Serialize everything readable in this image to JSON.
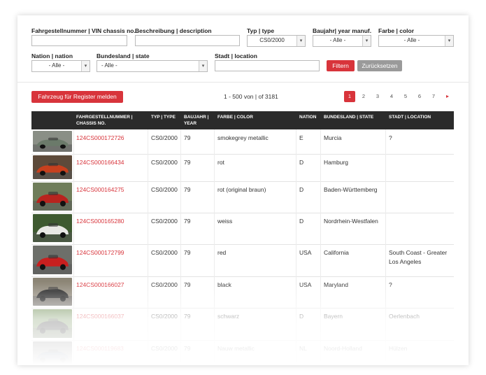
{
  "filters": {
    "vin_label": "Fahrgestellnummer | VIN chassis no.",
    "vin_value": "",
    "desc_label": "Beschreibung | description",
    "desc_value": "",
    "type_label": "Typ | type",
    "type_value": "CS0/2000",
    "year_label": "Baujahr| year manuf.",
    "year_value": "- Alle -",
    "color_label": "Farbe | color",
    "color_value": "- Alle -",
    "nation_label": "Nation | nation",
    "nation_value": "- Alle -",
    "state_label": "Bundesland | state",
    "state_value": "- Alle -",
    "city_label": "Stadt | location",
    "city_value": "",
    "filter_button": "Filtern",
    "reset_button": "Zurücksetzen"
  },
  "register_button": "Fahrzeug für Register melden",
  "result_count": "1 - 500 von | of 3181",
  "pagination": {
    "pages": [
      "1",
      "2",
      "3",
      "4",
      "5",
      "6",
      "7"
    ],
    "active": "1",
    "next": "▸"
  },
  "table": {
    "headers": {
      "chassis": "FAHRGESTELLNUMMER | CHASSIS NO.",
      "type": "TYP | TYPE",
      "year": "BAUJAHR | YEAR",
      "color": "FARBE | COLOR",
      "nation": "NATION",
      "state": "BUNDESLAND | STATE",
      "city": "STADT | LOCATION"
    },
    "rows": [
      {
        "chassis": "124CS000172726",
        "type": "CS0/2000",
        "year": "79",
        "color": "smokegrey metallic",
        "nation": "E",
        "state": "Murcia",
        "city": "?",
        "car": "#6b7a6a",
        "bg": "#8a8f86"
      },
      {
        "chassis": "124CS000166434",
        "type": "CS0/2000",
        "year": "79",
        "color": "rot",
        "nation": "D",
        "state": "Hamburg",
        "city": "",
        "car": "#c8401e",
        "bg": "#5d4a3a"
      },
      {
        "chassis": "124CS000164275",
        "type": "CS0/2000",
        "year": "79",
        "color": "rot (original braun)",
        "nation": "D",
        "state": "Baden-Württemberg",
        "city": "",
        "car": "#b8241e",
        "bg": "#6f7d5a"
      },
      {
        "chassis": "124CS000165280",
        "type": "CS0/2000",
        "year": "79",
        "color": "weiss",
        "nation": "D",
        "state": "Nordrhein-Westfalen",
        "city": "",
        "car": "#e8e8e4",
        "bg": "#3e5a30"
      },
      {
        "chassis": "124CS000172799",
        "type": "CS0/2000",
        "year": "79",
        "color": "red",
        "nation": "USA",
        "state": "California",
        "city": "South Coast - Greater Los Angeles",
        "car": "#c81f1f",
        "bg": "#6d6f6a"
      },
      {
        "chassis": "124CS000166027",
        "type": "CS0/2000",
        "year": "79",
        "color": "black",
        "nation": "USA",
        "state": "Maryland",
        "city": "?",
        "car": "#1e1e1e",
        "bg": "#8c8576"
      },
      {
        "chassis": "124CS000166037",
        "type": "CS0/2000",
        "year": "79",
        "color": "schwarz",
        "nation": "D",
        "state": "Bayern",
        "city": "Oerlenbach",
        "car": "#2a2a2a",
        "bg": "#6a8a50"
      },
      {
        "chassis": "124CS000119683",
        "type": "CS0/2000",
        "year": "79",
        "color": "Nauw metallic",
        "nation": "NL",
        "state": "Noord-Holland",
        "city": "Hülzen",
        "car": "#3a4a6a",
        "bg": "#777"
      }
    ]
  }
}
